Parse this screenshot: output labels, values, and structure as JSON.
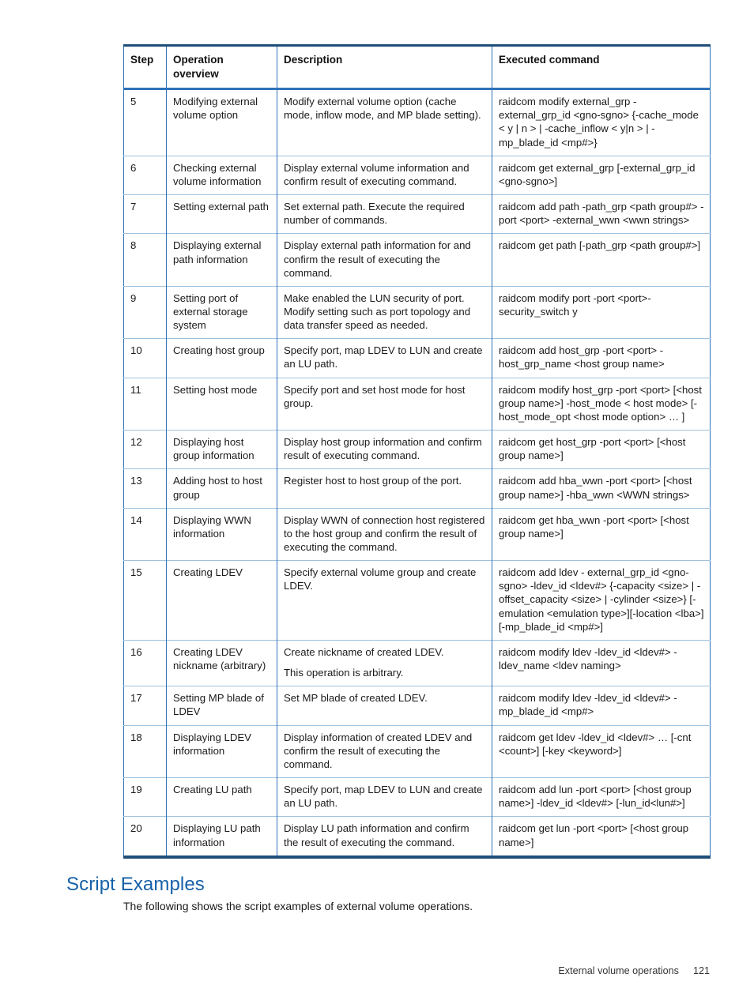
{
  "document": {
    "table": {
      "headers": [
        "Step",
        "Operation overview",
        "Description",
        "Executed command"
      ],
      "rows": [
        {
          "step": "5",
          "operation": "Modifying external volume option",
          "description": "Modify external volume option (cache mode, inflow mode, and MP blade setting).",
          "command": "raidcom modify external_grp -external_grp_id <gno-sgno> {-cache_mode < y | n >  | -cache_inflow < y|n > | -mp_blade_id <mp#>}"
        },
        {
          "step": "6",
          "operation": "Checking external volume information",
          "description": "Display external volume information and confirm result of executing command.",
          "command": "raidcom get external_grp [-external_grp_id <gno-sgno>]"
        },
        {
          "step": "7",
          "operation": "Setting external path",
          "description": "Set external path. Execute the required number of commands.",
          "command": "raidcom add path -path_grp <path group#> -port <port> -external_wwn <wwn strings>"
        },
        {
          "step": "8",
          "operation": "Displaying external path information",
          "description": "Display external path information for and confirm the result of executing the command.",
          "command": "raidcom get path [-path_grp <path group#>]"
        },
        {
          "step": "9",
          "operation": "Setting port of external storage system",
          "description": "Make enabled the LUN security of port. Modify setting such as port topology and data transfer speed as needed.",
          "command": "raidcom modify port -port <port>-security_switch y"
        },
        {
          "step": "10",
          "operation": "Creating host group",
          "description": "Specify port, map LDEV to LUN and create an LU path.",
          "command": "raidcom add host_grp -port <port> -host_grp_name <host group name>"
        },
        {
          "step": "11",
          "operation": "Setting host mode",
          "description": "Specify port and set host mode for host group.",
          "command": "raidcom modify host_grp -port <port> [<host group name>] -host_mode < host mode> [-host_mode_opt <host mode option> … ]"
        },
        {
          "step": "12",
          "operation": "Displaying host group information",
          "description": "Display host group information and confirm result of executing command.",
          "command": "raidcom get host_grp -port <port> [<host group name>]"
        },
        {
          "step": "13",
          "operation": "Adding host to host group",
          "description": "Register host to host group of the port.",
          "command": "raidcom add hba_wwn -port <port> [<host group name>] -hba_wwn <WWN strings>"
        },
        {
          "step": "14",
          "operation": "Displaying WWN information",
          "description": "Display WWN of connection host registered to the host group and confirm the result of executing the command.",
          "command": "raidcom get hba_wwn -port <port> [<host group name>]"
        },
        {
          "step": "15",
          "operation": "Creating LDEV",
          "description": "Specify external volume group and create LDEV.",
          "command": "raidcom add ldev - external_grp_id <gno-sgno> -ldev_id <ldev#> {-capacity <size> | -offset_capacity <size> | -cylinder <size>} [-emulation <emulation type>][-location <lba>][-mp_blade_id <mp#>]"
        },
        {
          "step": "16",
          "operation": "Creating LDEV nickname (arbitrary)",
          "description_lines": [
            "Create nickname of created LDEV.",
            "This operation is arbitrary."
          ],
          "command": "raidcom modify ldev -ldev_id <ldev#> -ldev_name <ldev naming>"
        },
        {
          "step": "17",
          "operation": "Setting MP blade of LDEV",
          "description": "Set MP blade of created LDEV.",
          "command": "raidcom modify ldev -ldev_id <ldev#> -mp_blade_id <mp#>"
        },
        {
          "step": "18",
          "operation": "Displaying LDEV information",
          "description": "Display information of created LDEV and confirm the result of executing the command.",
          "command": "raidcom get ldev -ldev_id <ldev#> … [-cnt <count>] [-key <keyword>]"
        },
        {
          "step": "19",
          "operation": "Creating LU path",
          "description": "Specify port, map LDEV to LUN and create an LU path.",
          "command": "raidcom add lun -port <port> [<host group name>] -ldev_id <ldev#> [-lun_id<lun#>]"
        },
        {
          "step": "20",
          "operation": "Displaying LU path information",
          "description": "Display LU path information and confirm the result of executing the command.",
          "command": "raidcom get lun -port <port> [<host group name>]"
        }
      ]
    },
    "section": {
      "heading": "Script Examples",
      "paragraph": "The following shows the script examples of external volume operations."
    },
    "footer": {
      "label": "External volume operations",
      "page": "121"
    },
    "colors": {
      "heading": "#1560a8",
      "table_outer_border": "#1f4e79",
      "table_inner_border": "#2f72b8",
      "row_divider": "#9fc2de"
    }
  }
}
